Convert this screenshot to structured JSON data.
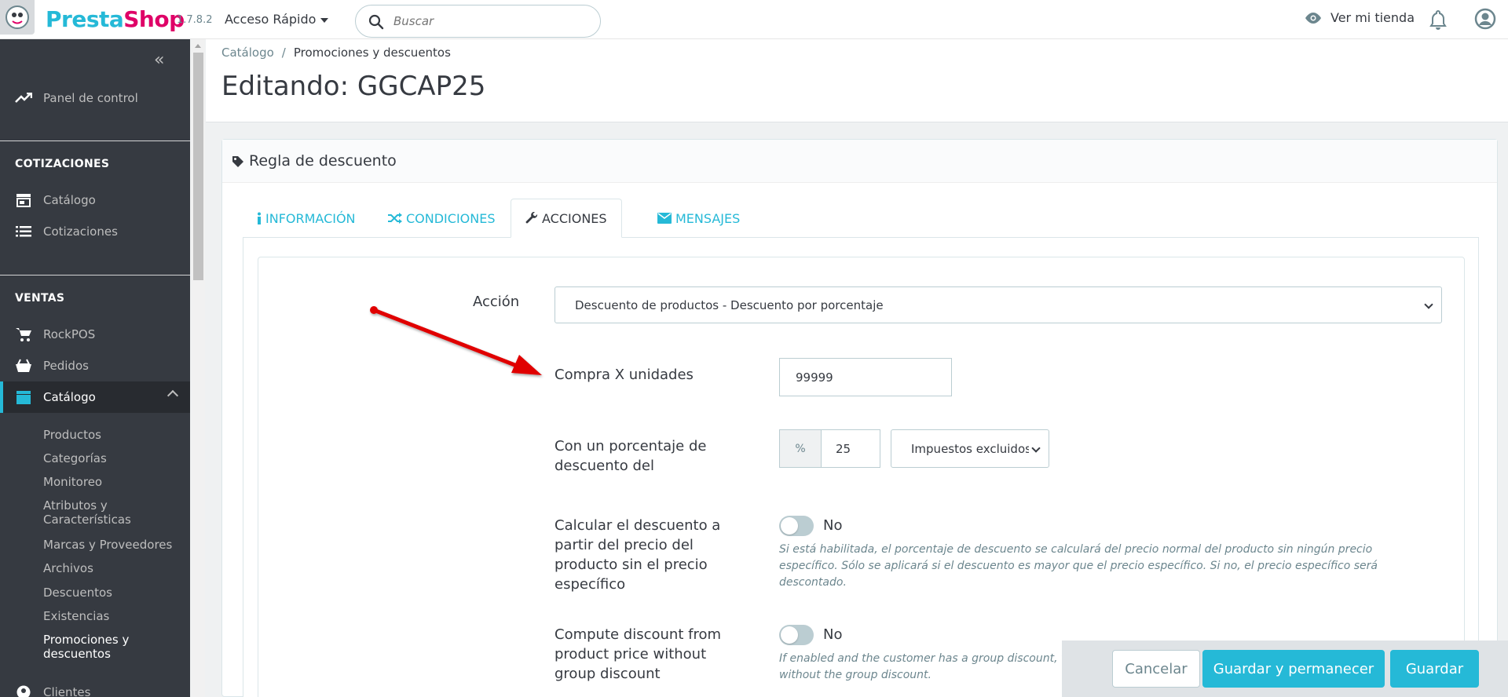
{
  "header": {
    "logo_brand_a": "Presta",
    "logo_brand_b": "Shop",
    "version": "1.7.8.2",
    "quick_access": "Acceso Rápido",
    "search_placeholder": "Buscar",
    "view_store": "Ver mi tienda"
  },
  "sidebar": {
    "dashboard": "Panel de control",
    "section_quotes": "COTIZACIONES",
    "quotes_catalog": "Catálogo",
    "quotes": "Cotizaciones",
    "section_sales": "VENTAS",
    "rockpos": "RockPOS",
    "orders": "Pedidos",
    "catalog": "Catálogo",
    "sub": [
      "Productos",
      "Categorías",
      "Monitoreo",
      "Atributos y Características",
      "Marcas y Proveedores",
      "Archivos",
      "Descuentos",
      "Existencias",
      "Promociones y descuentos"
    ],
    "customers": "Clientes"
  },
  "page": {
    "breadcrumb_parent": "Catálogo",
    "breadcrumb_sep": "/",
    "breadcrumb_current": "Promociones y descuentos",
    "title": "Editando: GGCAP25"
  },
  "panel": {
    "title": "Regla de descuento",
    "tabs": [
      "INFORMACIÓN",
      "CONDICIONES",
      "ACCIONES",
      "MENSAJES"
    ]
  },
  "form": {
    "action_label": "Acción",
    "action_value": "Descuento de productos - Descuento por porcentaje",
    "buy_x_label": "Compra X unidades",
    "buy_x_value": "99999",
    "percent_label": "Con un porcentaje de descuento del",
    "percent_addon": "%",
    "percent_value": "25",
    "tax_value": "Impuestos excluidos",
    "calc_label": "Calcular el descuento a partir del precio del producto sin el precio específico",
    "calc_toggle": "No",
    "calc_help": "Si está habilitada, el porcentaje de descuento se calculará del precio normal del producto sin ningún precio específico. Sólo se aplicará si el descuento es mayor que el precio específico. Si no, el precio específico será descontado.",
    "group_label": "Compute discount from product price without group discount",
    "group_toggle": "No",
    "group_help_1": "If enabled and the customer has a group discount, the",
    "group_help_2": "without the group discount."
  },
  "footer": {
    "cancel": "Cancelar",
    "save_stay": "Guardar y permanecer",
    "save": "Guardar"
  },
  "colors": {
    "accent": "#25b9d7",
    "brand_pink": "#df0067",
    "sidebar_bg": "#363a41",
    "arrow": "#e00000"
  }
}
